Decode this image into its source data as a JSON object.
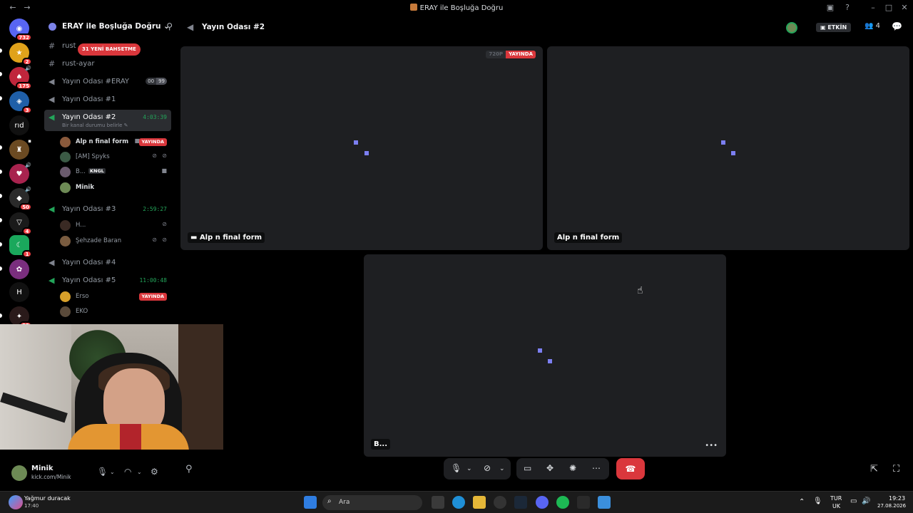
{
  "window": {
    "title": "ERAY ile Boşluğa Doğru"
  },
  "server_rail": {
    "items": [
      {
        "name": "home",
        "badge": "732"
      },
      {
        "name": "server-1",
        "badge": "2"
      },
      {
        "name": "server-2",
        "badge": "175"
      },
      {
        "name": "server-3",
        "badge": "3"
      },
      {
        "name": "server-4",
        "label": "rıd"
      },
      {
        "name": "server-5",
        "badge": ""
      },
      {
        "name": "server-6",
        "badge": ""
      },
      {
        "name": "server-7",
        "badge": "50"
      },
      {
        "name": "server-8",
        "badge": "4"
      },
      {
        "name": "server-9",
        "badge": "1"
      },
      {
        "name": "server-10",
        "badge": ""
      },
      {
        "name": "server-11",
        "label": "H"
      },
      {
        "name": "server-12",
        "badge": "23"
      }
    ]
  },
  "sidebar": {
    "server_name": "ERAY ile Boşluğa Doğru",
    "mention_pill": "31 YENİ BAHSETME",
    "channels": [
      {
        "name": "rust",
        "type": "text"
      },
      {
        "name": "rust-ayar",
        "type": "text"
      },
      {
        "name": "Yayın Odası #ERAY",
        "type": "voice",
        "counts": [
          "00",
          "99"
        ]
      },
      {
        "name": "Yayın Odası #1",
        "type": "voice"
      },
      {
        "name": "Yayın Odası #2",
        "type": "voice",
        "timer": "4:03:39",
        "status": "Bir kanal durumu belirle"
      },
      {
        "name": "Yayın Odası #3",
        "type": "voice",
        "timer": "2:59:27"
      },
      {
        "name": "Yayın Odası #4",
        "type": "voice"
      },
      {
        "name": "Yayın Odası #5",
        "type": "voice",
        "timer": "11:00:48"
      }
    ],
    "room2_users": [
      {
        "name": "Alp n final form",
        "live": "YAYINDA"
      },
      {
        "name": "[AM] Spyks"
      },
      {
        "name": "B...",
        "tag": "KNGL"
      },
      {
        "name": "Minik"
      }
    ],
    "room3_users": [
      {
        "name": "H..."
      },
      {
        "name": "Şehzade Baran"
      }
    ],
    "room5_users": [
      {
        "name": "Erso",
        "live": "YAYINDA"
      },
      {
        "name": "EKO"
      }
    ]
  },
  "user_panel": {
    "name": "Minik",
    "status": "kick.com/Minik"
  },
  "header": {
    "channel": "Yayın Odası #2",
    "activity": "ETKİN",
    "participants": "4"
  },
  "tiles": [
    {
      "name": "Alp n final form",
      "quality": "720P",
      "live": "YAYINDA"
    },
    {
      "name": "Alp n final form"
    },
    {
      "name": "B..."
    }
  ],
  "taskbar": {
    "weather_title": "Yağmur duracak",
    "weather_sub": "17:40",
    "search_placeholder": "Ara",
    "lang_top": "TUR",
    "lang_bottom": "UK",
    "time": "19:23",
    "date": "27.08.2026"
  },
  "colors": {
    "accent": "#7c7ff2",
    "danger": "#da373c",
    "online": "#23a55a"
  }
}
